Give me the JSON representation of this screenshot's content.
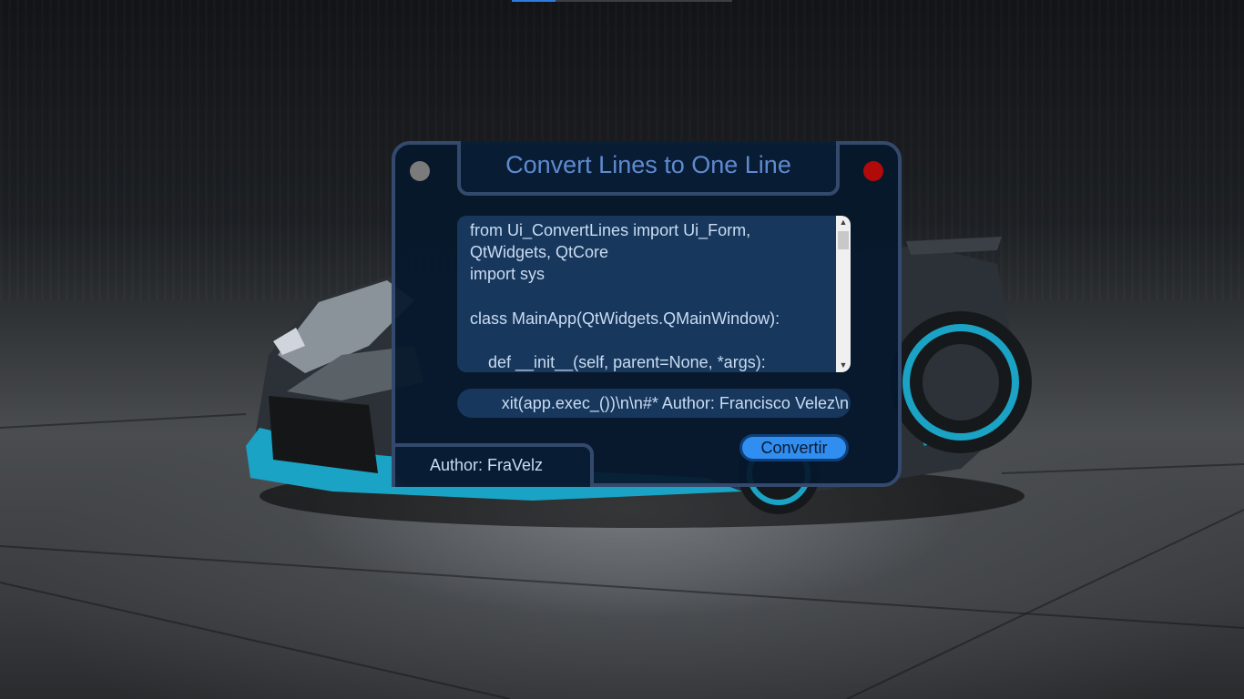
{
  "window": {
    "title": "Convert Lines to One Line",
    "minimize_icon": "gray-dot-icon",
    "close_icon": "red-dot-icon"
  },
  "input": {
    "text": "from Ui_ConvertLines import Ui_Form, QtWidgets, QtCore\nimport sys\n\nclass MainApp(QtWidgets.QMainWindow):\n\n    def __init__(self, parent=None, *args):"
  },
  "output": {
    "value": "xit(app.exec_())\\n\\n#* Author: Francisco Velez\\n"
  },
  "convert_button": {
    "label": "Convertir"
  },
  "footer": {
    "author": "Author: FraVelz"
  },
  "colors": {
    "title": "#5f8ad2",
    "frame": "#344a6d",
    "button": "#2f8ef0",
    "close_dot": "#b10a0a",
    "minimize_dot": "#7b7b7b"
  }
}
